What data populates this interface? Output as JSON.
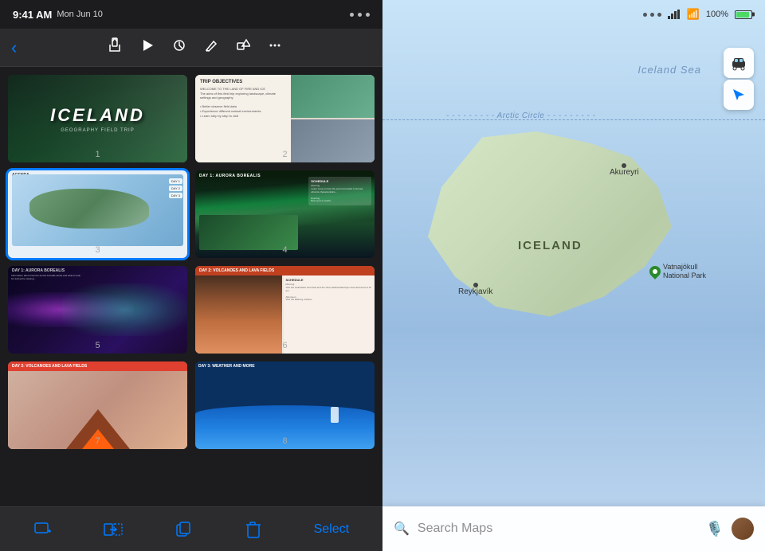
{
  "left_panel": {
    "status_bar": {
      "time": "9:41 AM",
      "date": "Mon Jun 10"
    },
    "toolbar": {
      "back_label": "‹",
      "share_icon": "share",
      "play_icon": "play",
      "revert_icon": "revert",
      "draw_icon": "draw",
      "shapes_icon": "shapes",
      "more_icon": "more"
    },
    "slides": [
      {
        "number": "1",
        "title": "ICELAND",
        "subtitle": "GEOGRAPHY FIELD TRIP",
        "selected": false
      },
      {
        "number": "2",
        "title": "TRIP OBJECTIVES",
        "selected": false
      },
      {
        "number": "3",
        "title": "AGENDA",
        "selected": true
      },
      {
        "number": "4",
        "title": "DAY 1: AURORA BOREALIS",
        "selected": false
      },
      {
        "number": "5",
        "title": "DAY 1: AURORA BOREALIS",
        "selected": false
      },
      {
        "number": "6",
        "title": "DAY 2: VOLCANOES AND LAVA FIELDS",
        "selected": false
      },
      {
        "number": "7",
        "title": "DAY 2: VOLCANOES AND LAVA FIELDS",
        "selected": false
      },
      {
        "number": "8",
        "title": "DAY 3: WEATHER AND MORE",
        "selected": false
      }
    ],
    "bottom_toolbar": {
      "add_label": "+",
      "transition_label": "transition",
      "duplicate_label": "duplicate",
      "delete_label": "delete",
      "select_label": "Select"
    }
  },
  "right_panel": {
    "status_bar": {
      "battery_pct": "100%"
    },
    "map": {
      "ocean_label": "Iceland Sea",
      "arctic_label": "Arctic Circle",
      "country_label": "ICELAND",
      "cities": [
        {
          "name": "Reykjavík",
          "position": "reykjavik"
        },
        {
          "name": "Akureyri",
          "position": "akureyri"
        }
      ],
      "parks": [
        {
          "name": "Vatnajökull\nNational Park",
          "position": "vatnajokull"
        }
      ]
    },
    "search": {
      "placeholder": "Search Maps"
    },
    "controls": {
      "drive_icon": "car",
      "location_icon": "location-arrow"
    }
  }
}
